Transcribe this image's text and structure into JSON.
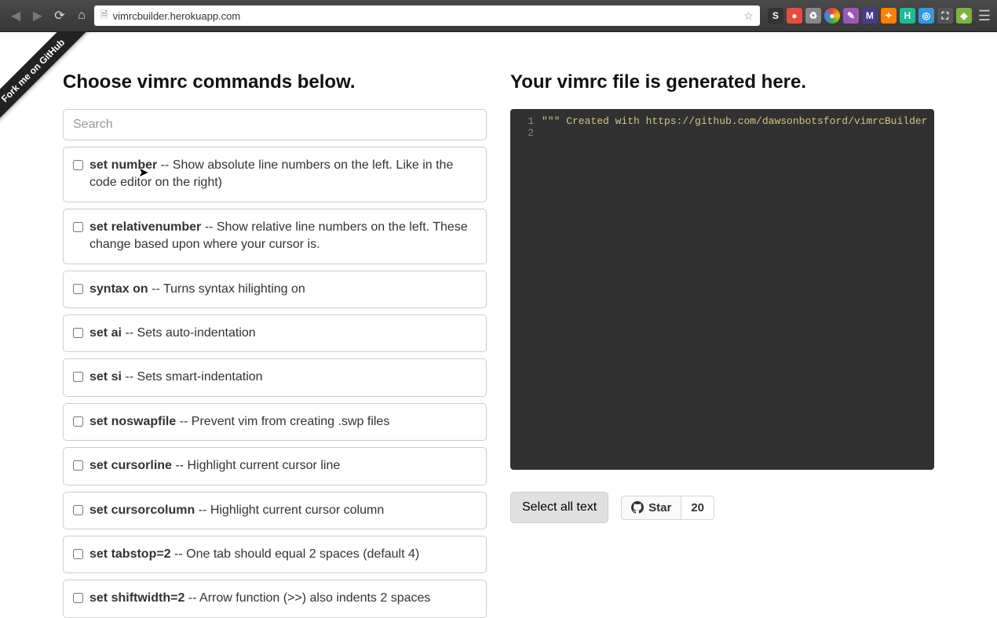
{
  "browser": {
    "url": "vimrcbuilder.herokuapp.com",
    "extensions": [
      {
        "bg": "#333333",
        "label": "S"
      },
      {
        "bg": "#e74c3c",
        "label": "●"
      },
      {
        "bg": "#888888",
        "label": "♻"
      },
      {
        "bg": "#fff",
        "label": "●",
        "border": true,
        "gradient": true
      },
      {
        "bg": "#9b59b6",
        "label": "✎"
      },
      {
        "bg": "#4a3a8a",
        "label": "M"
      },
      {
        "bg": "#ff7f00",
        "label": "✦"
      },
      {
        "bg": "#1abc9c",
        "label": "H"
      },
      {
        "bg": "#3498db",
        "label": "◎"
      },
      {
        "bg": "#555",
        "label": "⛶"
      },
      {
        "bg": "#7cb342",
        "label": "◆"
      }
    ]
  },
  "ribbon": "Fork me on GitHub",
  "left": {
    "heading": "Choose vimrc commands below.",
    "search_placeholder": "Search",
    "commands": [
      {
        "name": "set number",
        "desc": " -- Show absolute line numbers on the left. Like in the code editor on the right)"
      },
      {
        "name": "set relativenumber",
        "desc": " -- Show relative line numbers on the left. These change based upon where your cursor is."
      },
      {
        "name": "syntax on",
        "desc": " -- Turns syntax hilighting on"
      },
      {
        "name": "set ai",
        "desc": " -- Sets auto-indentation"
      },
      {
        "name": "set si",
        "desc": " -- Sets smart-indentation"
      },
      {
        "name": "set noswapfile",
        "desc": " -- Prevent vim from creating .swp files"
      },
      {
        "name": "set cursorline",
        "desc": " -- Highlight current cursor line"
      },
      {
        "name": "set cursorcolumn",
        "desc": " -- Highlight current cursor column"
      },
      {
        "name": "set tabstop=2",
        "desc": " -- One tab should equal 2 spaces (default 4)"
      },
      {
        "name": "set shiftwidth=2",
        "desc": " -- Arrow function (>>) also indents 2 spaces"
      }
    ]
  },
  "right": {
    "heading": "Your vimrc file is generated here.",
    "lines": [
      {
        "n": "1",
        "text": "\"\"\" Created with https://github.com/dawsonbotsford/vimrcBuilder \"\"\""
      },
      {
        "n": "2",
        "text": ""
      }
    ],
    "select_all": "Select all text",
    "star_label": "Star",
    "star_count": "20"
  }
}
